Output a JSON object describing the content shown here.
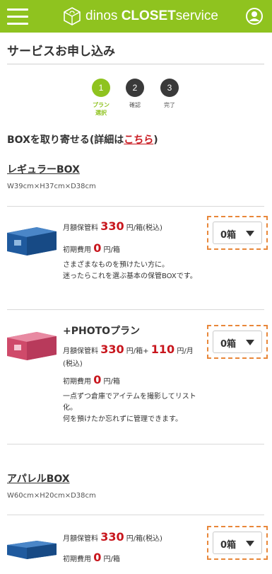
{
  "header": {
    "logo_prefix": "dinos",
    "logo_main": "CLOSET",
    "logo_suffix": "service",
    "brand_color": "#8fc31f"
  },
  "page_title": "サービスお申し込み",
  "steps": [
    {
      "num": "1",
      "label_1": "プラン",
      "label_2": "選択",
      "active": true
    },
    {
      "num": "2",
      "label_1": "確認",
      "label_2": "",
      "active": false
    },
    {
      "num": "3",
      "label_1": "完了",
      "label_2": "",
      "active": false
    }
  ],
  "section": {
    "heading_prefix": "BOXを取り寄せる(詳細は",
    "heading_link": "こちら",
    "heading_suffix": ")"
  },
  "regular_box": {
    "name": "レギュラーBOX",
    "size": "W39cm×H37cm×D38cm",
    "items": [
      {
        "fee_label": "月額保管料",
        "fee_value": "330",
        "fee_unit": "円/箱(税込)",
        "initial_label": "初期費用",
        "initial_value": "0",
        "initial_unit": "円/箱",
        "desc_1": "さまざまなものを預けたい方に。",
        "desc_2": "迷ったらこれを選ぶ基本の保管BOXです。",
        "select_value": "0箱"
      },
      {
        "title": "+PHOTOプラン",
        "fee_label": "月額保管料",
        "fee_value": "330",
        "fee_unit": "円/箱",
        "plus": "+",
        "extra_value": "110",
        "extra_unit": "円/月",
        "tax": "(税込)",
        "initial_label": "初期費用",
        "initial_value": "0",
        "initial_unit": "円/箱",
        "desc_1": "一点ずつ倉庫でアイテムを撮影してリスト化。",
        "desc_2": "何を預けたか忘れずに管理できます。",
        "select_value": "0箱"
      }
    ]
  },
  "apparel_box": {
    "name": "アパレルBOX",
    "size": "W60cm×H20cm×D38cm",
    "items": [
      {
        "fee_label": "月額保管料",
        "fee_value": "330",
        "fee_unit": "円/箱(税込)",
        "initial_label": "初期費用",
        "initial_value": "0",
        "initial_unit": "円/箱",
        "select_value": "0箱"
      }
    ]
  },
  "colors": {
    "accent": "#8fc31f",
    "price_red": "#c8161d",
    "highlight_dash": "#e8873a"
  }
}
